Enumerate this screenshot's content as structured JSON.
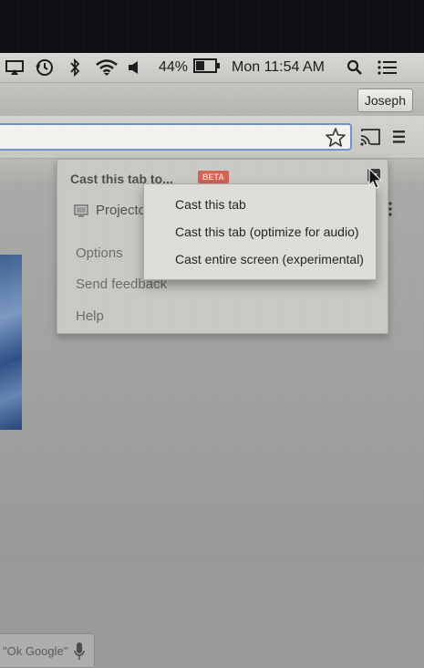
{
  "menubar": {
    "battery_percent": "44%",
    "clock": "Mon 11:54 AM",
    "icons": [
      "airplay-icon",
      "time-machine-icon",
      "bluetooth-icon",
      "wifi-icon",
      "volume-icon",
      "battery-icon",
      "spotlight-icon",
      "notification-center-icon"
    ]
  },
  "tabstrip": {
    "profile_name": "Joseph"
  },
  "toolbar": {
    "icons": [
      "bookmark-star-icon",
      "cast-icon",
      "chrome-menu-icon"
    ]
  },
  "cast_panel": {
    "title": "Cast this tab to...",
    "beta_label": "BETA",
    "sink_name": "Projecto",
    "options_label": "Options",
    "feedback_label": "Send feedback",
    "help_label": "Help"
  },
  "cast_submenu": {
    "items": [
      "Cast this tab",
      "Cast this tab (optimize for audio)",
      "Cast entire screen (experimental)"
    ]
  },
  "page": {
    "search_hint": "\"Ok Google\""
  },
  "colors": {
    "beta_badge": "#cf6355",
    "omnibox_focus": "#6f93c9"
  }
}
